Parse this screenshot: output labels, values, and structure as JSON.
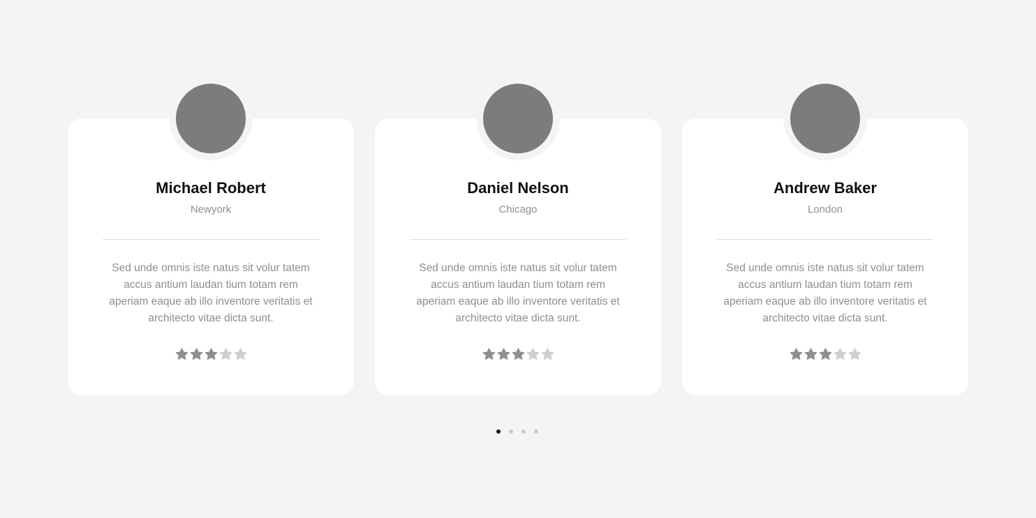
{
  "testimonials": [
    {
      "name": "Michael Robert",
      "city": "Newyork",
      "quote": "Sed unde omnis iste natus sit volur tatem accus antium laudan tium totam rem aperiam eaque ab illo inventore veritatis et architecto vitae dicta sunt.",
      "rating": 3,
      "rating_max": 5
    },
    {
      "name": "Daniel Nelson",
      "city": "Chicago",
      "quote": "Sed unde omnis iste natus sit volur tatem accus antium laudan tium totam rem aperiam eaque ab illo inventore veritatis et architecto vitae dicta sunt.",
      "rating": 3,
      "rating_max": 5
    },
    {
      "name": "Andrew Baker",
      "city": "London",
      "quote": "Sed unde omnis iste natus sit volur tatem accus antium laudan tium totam rem aperiam eaque ab illo inventore veritatis et architecto vitae dicta sunt.",
      "rating": 3,
      "rating_max": 5
    }
  ],
  "pagination": {
    "total": 4,
    "active_index": 0
  },
  "colors": {
    "background": "#f4f4f4",
    "card": "#ffffff",
    "avatar_placeholder": "#7b7c7d",
    "star_filled": "#8f8f8f",
    "star_empty": "#cfcfcf",
    "dot_active": "#111111",
    "dot_inactive": "#c9c9c9"
  },
  "icons": {
    "star": "star-icon"
  }
}
